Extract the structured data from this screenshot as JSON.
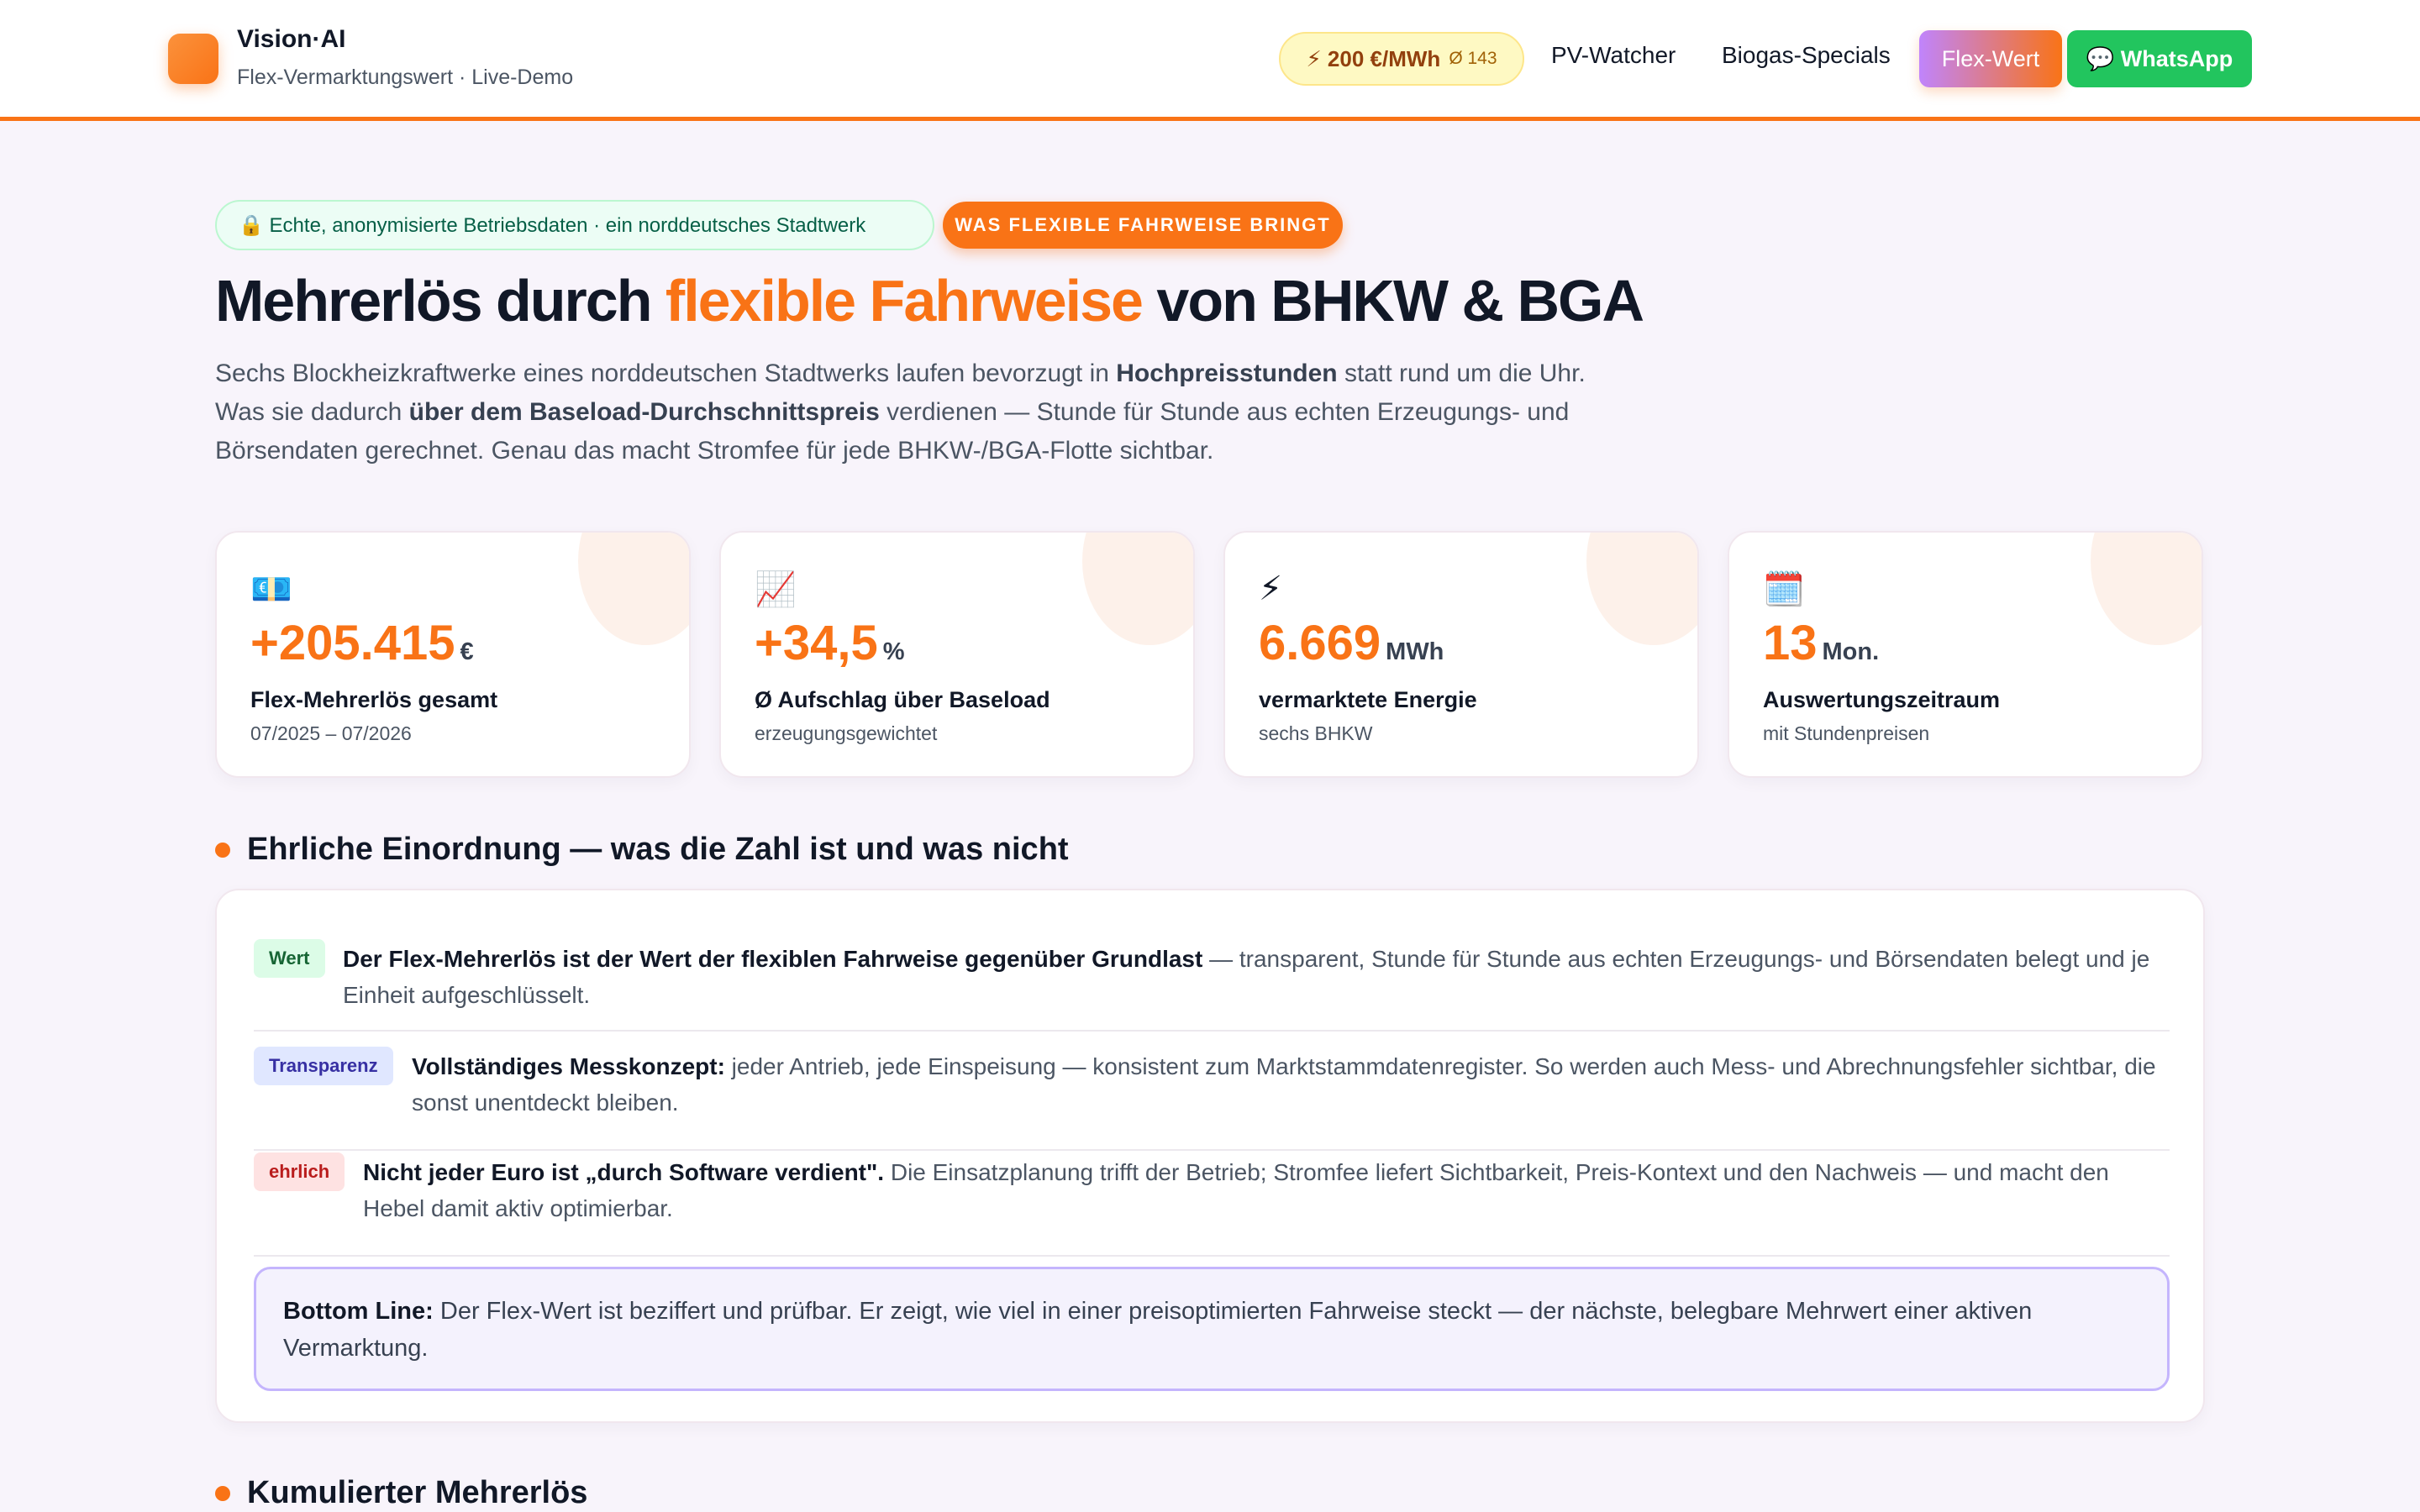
{
  "header": {
    "brand": "Vision·AI",
    "subtitle": "Flex-Vermarktungswert · Live-Demo",
    "price_pill": {
      "value": "⚡ 200 €/MWh",
      "avg": "Ø 143"
    },
    "nav": [
      "PV-Watcher",
      "Biogas-Specials"
    ],
    "btn_flex": "Flex-Wert",
    "btn_whatsapp": "💬 WhatsApp"
  },
  "hero": {
    "badge_data": "🔒 Echte, anonymisierte Betriebsdaten · ein norddeutsches Stadtwerk",
    "badge_orange": "WAS FLEXIBLE FAHRWEISE BRINGT",
    "title_pre": "Mehrerlös durch ",
    "title_accent": "flexible Fahrweise",
    "title_post": " von BHKW & BGA",
    "text": {
      "p1": "Sechs Blockheizkraftwerke eines norddeutschen Stadtwerks laufen bevorzugt in ",
      "b1": "Hochpreisstunden",
      "p2": " statt rund um die Uhr. Was sie dadurch ",
      "b2": "über dem Baseload-Durchschnittspreis",
      "p3": " verdienen — Stunde für Stunde aus echten Erzeugungs- und Börsendaten gerechnet. Genau das macht Stromfee für jede BHKW-/BGA-Flotte sichtbar."
    }
  },
  "stats": [
    {
      "icon": "💶",
      "value": "+205.415",
      "unit": "€",
      "label": "Flex-Mehrerlös gesamt",
      "sub": "07/2025 – 07/2026"
    },
    {
      "icon": "📈",
      "value": "+34,5",
      "unit": "%",
      "label": "Ø Aufschlag über Baseload",
      "sub": "erzeugungsgewichtet"
    },
    {
      "icon": "⚡",
      "value": "6.669",
      "unit": "MWh",
      "label": "vermarktete Energie",
      "sub": "sechs BHKW"
    },
    {
      "icon": "🗓️",
      "value": "13",
      "unit": "Mon.",
      "label": "Auswertungszeitraum",
      "sub": "mit Stundenpreisen"
    }
  ],
  "section1": {
    "title": "Ehrliche Einordnung — was die Zahl ist und was nicht",
    "rows": [
      {
        "tag": "Wert",
        "bold": "Der Flex-Mehrerlös ist der Wert der flexiblen Fahrweise gegenüber Grundlast",
        "text": " — transparent, Stunde für Stunde aus echten Erzeugungs- und Börsendaten belegt und je Einheit aufgeschlüsselt."
      },
      {
        "tag": "Transparenz",
        "bold": "Vollständiges Messkonzept:",
        "text": " jeder Antrieb, jede Einspeisung — konsistent zum Marktstammdatenregister. So werden auch Mess- und Abrechnungsfehler sichtbar, die sonst unentdeckt bleiben."
      },
      {
        "tag": "ehrlich",
        "bold": "Nicht jeder Euro ist „durch Software verdient\".",
        "text": " Die Einsatzplanung trifft der Betrieb; Stromfee liefert Sichtbarkeit, Preis-Kontext und den Nachweis — und macht den Hebel damit aktiv optimierbar."
      }
    ],
    "bottom_line": {
      "label": "Bottom Line:",
      "text": " Der Flex-Wert ist beziffert und prüfbar. Er zeigt, wie viel in einer preisoptimierten Fahrweise steckt — der nächste, belegbare Mehrwert einer aktiven Vermarktung."
    }
  },
  "section2": {
    "title": "Kumulierter Mehrerlös"
  },
  "colors": {
    "accent": "#f97316",
    "whatsapp": "#22c55e",
    "bottom_line_border": "#c4b5fd"
  }
}
